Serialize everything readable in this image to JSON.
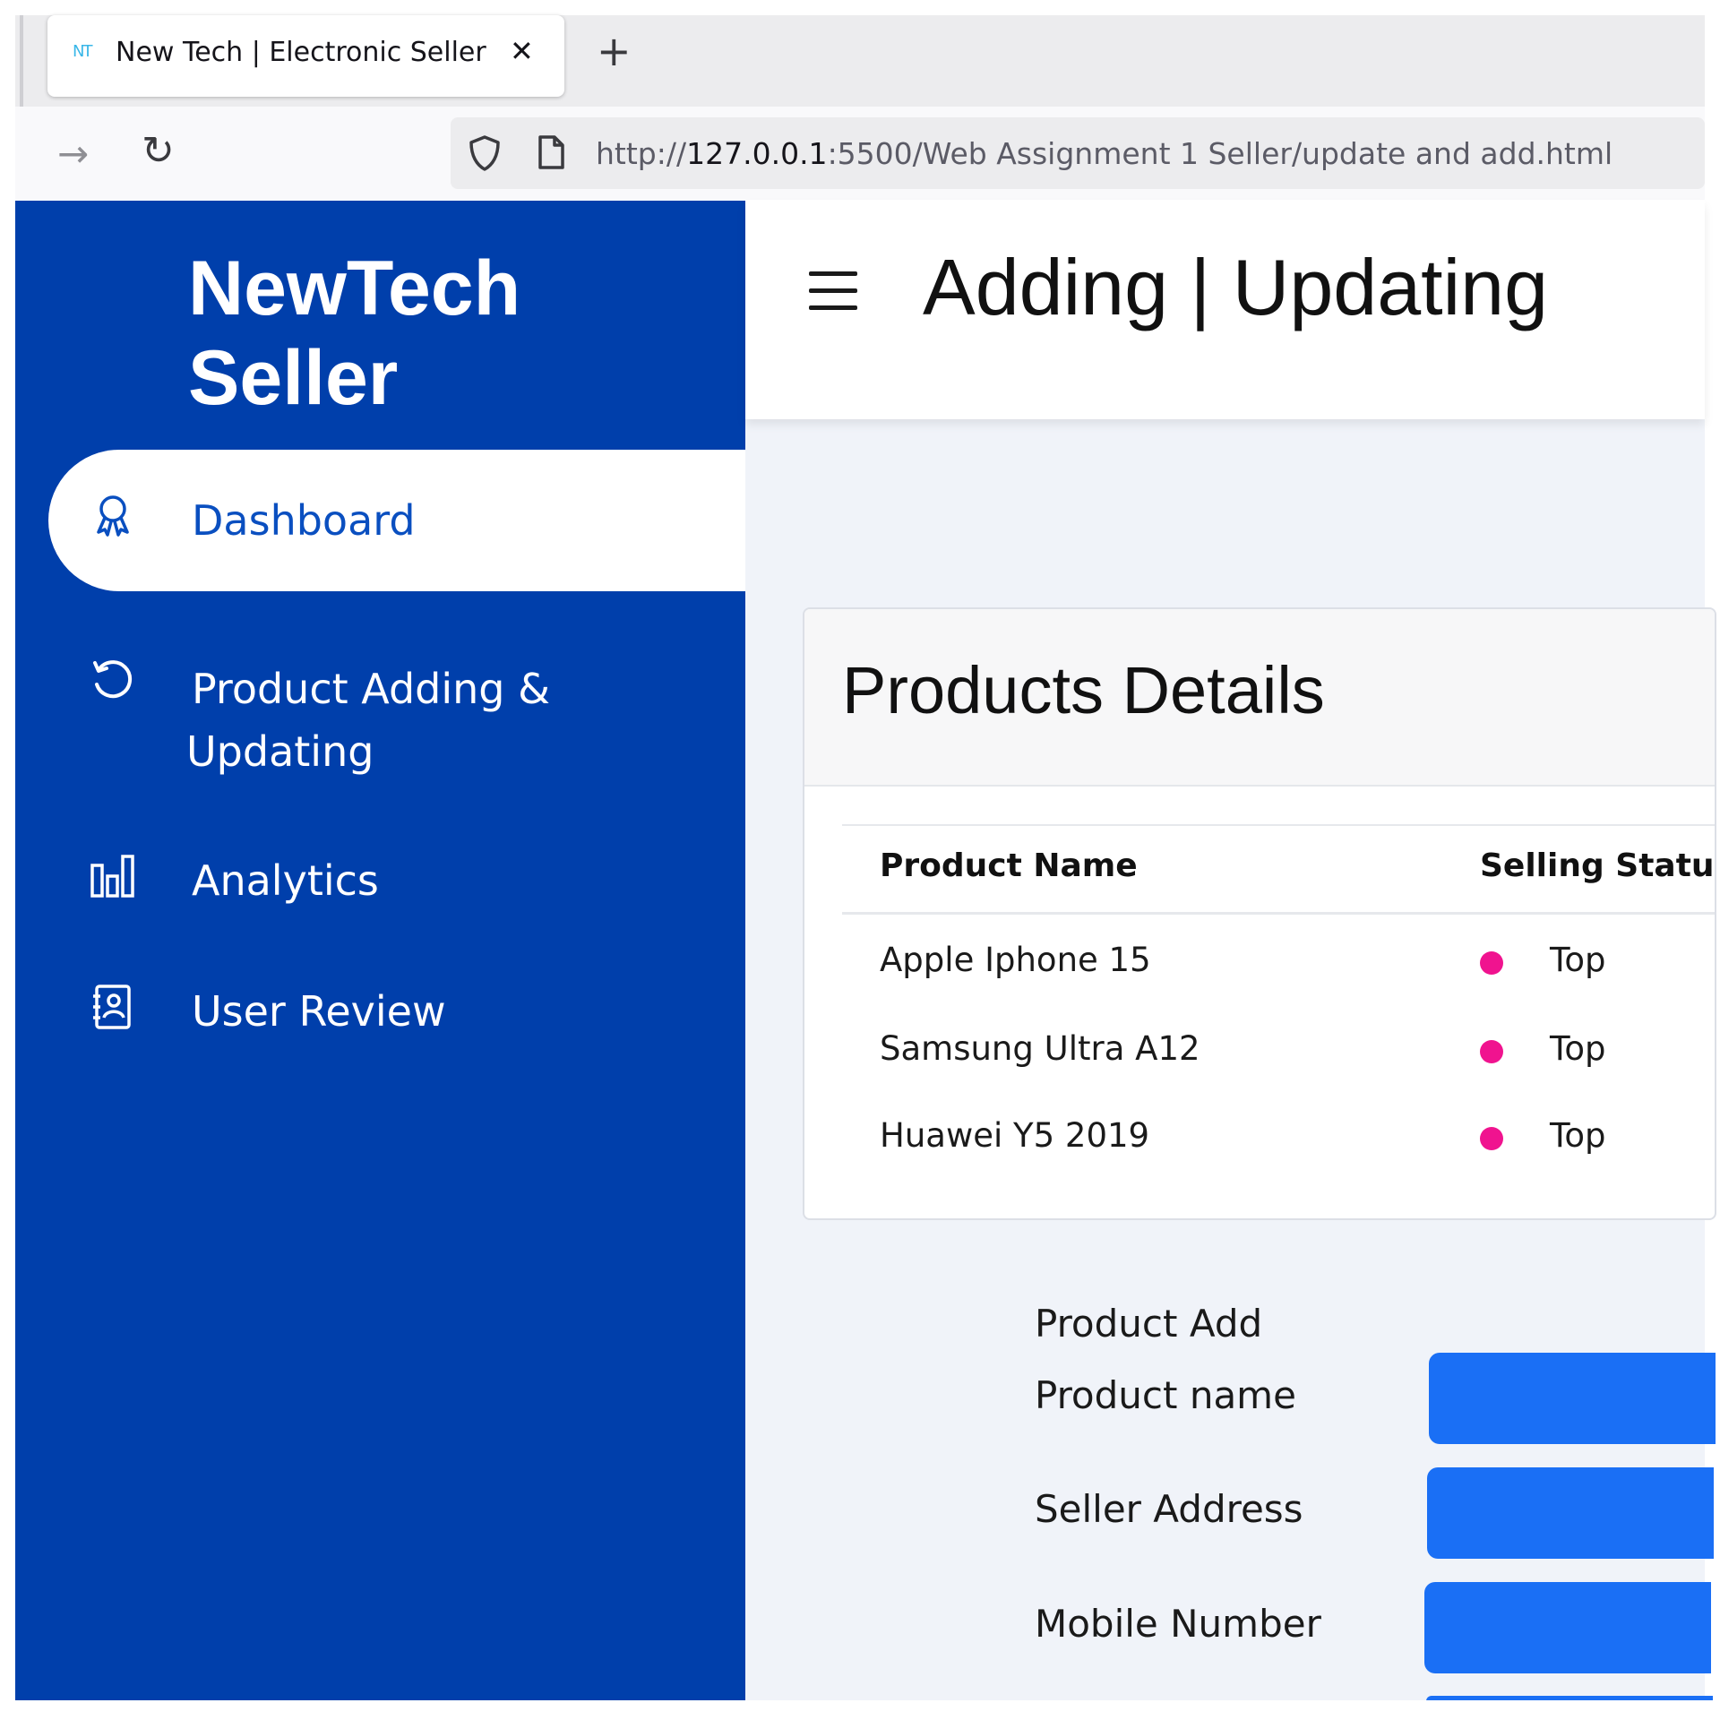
{
  "browser": {
    "tab_title": "New Tech | Electronic Seller",
    "tab_favicon": "NT",
    "close_glyph": "✕",
    "newtab_glyph": "+",
    "url_prefix": "http://",
    "url_host": "127.0.0.1",
    "url_rest": ":5500/Web Assignment 1 Seller/update and add.html",
    "forward_glyph": "→",
    "reload_glyph": "↻"
  },
  "sidebar": {
    "brand": "NewTech Seller",
    "items": [
      {
        "label": "Dashboard",
        "icon": "award-icon",
        "active": true
      },
      {
        "label": "Product Adding & Updating",
        "icon": "history-icon",
        "active": false
      },
      {
        "label": "Analytics",
        "icon": "bar-chart-icon",
        "active": false
      },
      {
        "label": "User Review",
        "icon": "contact-book-icon",
        "active": false
      }
    ]
  },
  "header": {
    "title": "Adding | Updating",
    "menu_icon": "hamburger-menu-icon"
  },
  "products": {
    "title": "Products Details",
    "columns": [
      "Product Name",
      "Selling Status"
    ],
    "rows": [
      {
        "name": "Apple Iphone 15",
        "status": "Top"
      },
      {
        "name": "Samsung Ultra A12",
        "status": "Top"
      },
      {
        "name": "Huawei Y5 2019",
        "status": "Top"
      }
    ],
    "status_color": "#f0138f"
  },
  "form": {
    "heading": "Product Add",
    "fields": [
      {
        "label": "Product name",
        "value": ""
      },
      {
        "label": "Seller Address",
        "value": ""
      },
      {
        "label": "Mobile Number",
        "value": ""
      }
    ],
    "input_color": "#1a6ff5"
  },
  "colors": {
    "sidebar": "#003fab",
    "main_bg": "#f0f3f9"
  }
}
